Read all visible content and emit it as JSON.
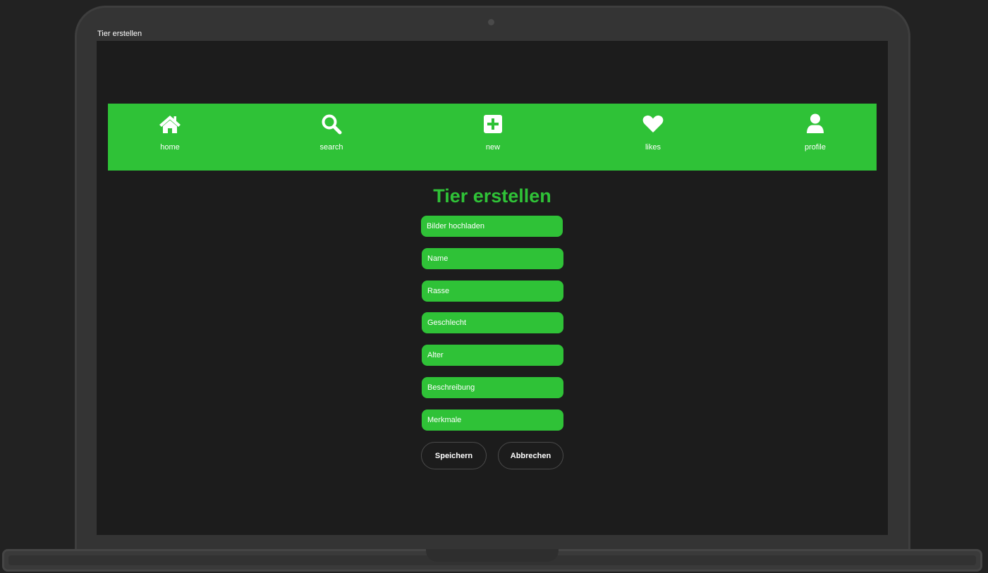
{
  "window": {
    "title": "Tier erstellen"
  },
  "nav": {
    "items": [
      {
        "label": "home",
        "icon": "home-icon"
      },
      {
        "label": "search",
        "icon": "search-icon"
      },
      {
        "label": "new",
        "icon": "plus-square-icon"
      },
      {
        "label": "likes",
        "icon": "heart-icon"
      },
      {
        "label": "profile",
        "icon": "user-icon"
      }
    ]
  },
  "form": {
    "title": "Tier erstellen",
    "upload_label": "Bilder hochladen",
    "fields": [
      "Name",
      "Rasse",
      "Geschlecht",
      "Alter",
      "Beschreibung",
      "Merkmale"
    ],
    "save_label": "Speichern",
    "cancel_label": "Abbrechen"
  },
  "colors": {
    "accent": "#2fc237",
    "background": "#1c1c1c",
    "text": "#ffffff"
  }
}
